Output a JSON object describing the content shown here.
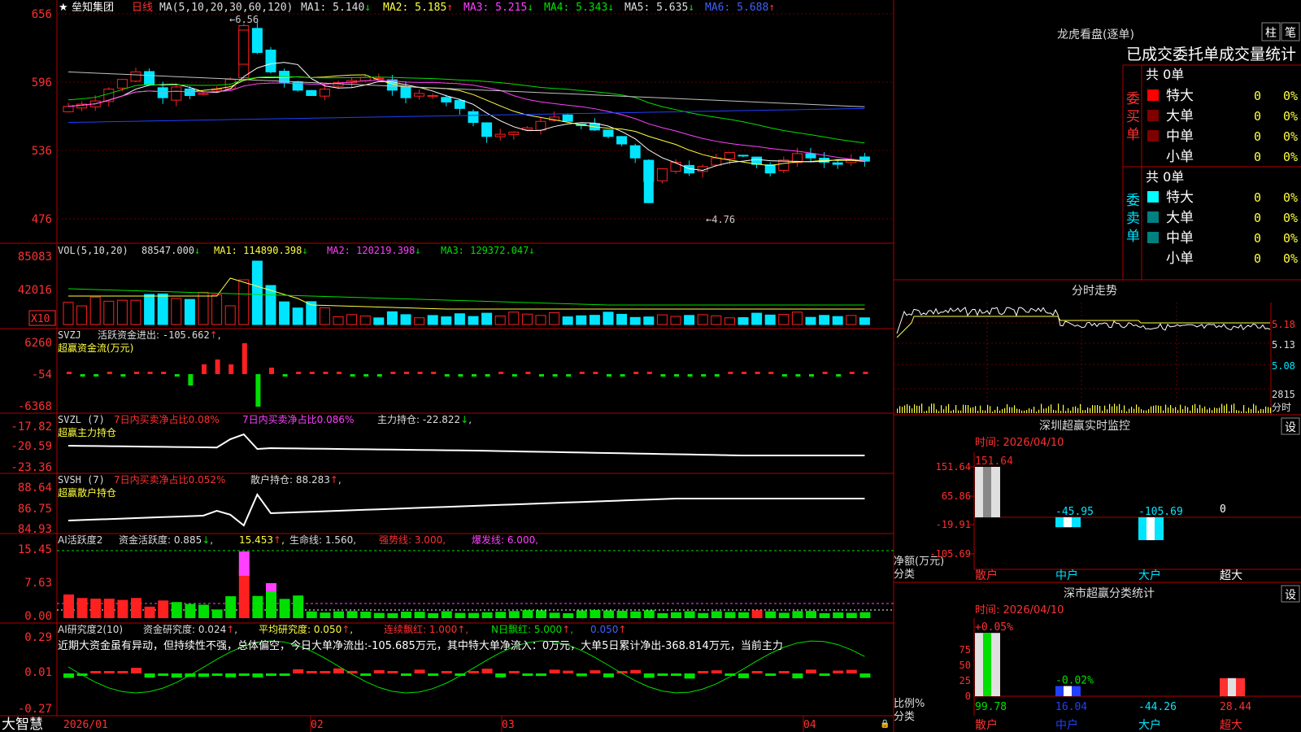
{
  "colors": {
    "up": "#ff2020",
    "down": "#00e5ff",
    "grid": "#b00000",
    "yellow": "#ffff40",
    "magenta": "#ff40ff",
    "green": "#00e000",
    "white": "#ffffff",
    "blue": "#2040ff",
    "grey": "#c0c0c0"
  },
  "stock": {
    "name": "垒知集团",
    "period": "日线",
    "star": "★"
  },
  "main": {
    "ma_params": "MA(5,10,20,30,60,120)",
    "ma": [
      {
        "label": "MA1:",
        "value": "5.140",
        "dir": "↓"
      },
      {
        "label": "MA2:",
        "value": "5.185",
        "dir": "↑"
      },
      {
        "label": "MA3:",
        "value": "5.215",
        "dir": "↓"
      },
      {
        "label": "MA4:",
        "value": "5.343",
        "dir": "↓"
      },
      {
        "label": "MA5:",
        "value": "5.635",
        "dir": "↓"
      },
      {
        "label": "MA6:",
        "value": "5.688",
        "dir": "↑"
      }
    ],
    "y_ticks": [
      "656",
      "596",
      "536",
      "476"
    ],
    "high_label": "6.56",
    "low_label": "4.76"
  },
  "vol": {
    "title": "VOL(5,10,20)",
    "value": "88547.000",
    "dir": "↓",
    "ma1": "MA1: 114890.398",
    "ma2": "MA2: 120219.398",
    "ma3": "MA3: 129372.047",
    "y_ticks": [
      "85083",
      "42016"
    ],
    "unit": "X10"
  },
  "svzj": {
    "title": "SVZJ",
    "label": "活跃资金进出:",
    "value": "-105.662",
    "dir": "↑",
    "sub": "超赢资金流(万元)",
    "y_ticks": [
      "6260",
      "-54",
      "-6368"
    ]
  },
  "svzl": {
    "title": "SVZL (7)",
    "ratio1": "7日内买卖净占比0.08%",
    "ratio2": "7日内买卖净占比0.086%",
    "hold": "主力持仓: -22.822",
    "dir": "↓",
    "sub": "超赢主力持仓",
    "y_ticks": [
      "-17.82",
      "-20.59",
      "-23.36"
    ]
  },
  "svsh": {
    "title": "SVSH (7)",
    "ratio": "7日内买卖净占比0.052%",
    "hold": "散户持仓: 88.283",
    "dir": "↑",
    "sub": "超赢散户持仓",
    "y_ticks": [
      "88.64",
      "86.75",
      "84.93"
    ]
  },
  "ai1": {
    "title": "AI活跃度2",
    "l1": "资金活跃度: 0.885",
    "l2": "15.453",
    "l3": "生命线: 1.560",
    "l4": "强势线: 3.000",
    "l5": "爆发线: 6.000",
    "y_ticks": [
      "15.45",
      "7.63",
      "0.00"
    ]
  },
  "ai2": {
    "title": "AI研究度2(10)",
    "l1": "资金研究度: 0.024",
    "l2": "平均研究度: 0.050",
    "l3": "连续飘红: 1.000",
    "l4": "N日飘红: 5.000",
    "l5": "0.050",
    "commentary": "近期大资金虽有异动，但持续性不强，总体偏空，今日大单净流出:-105.685万元，其中特大单净流入：0万元，大单5日累计净出-368.814万元，当前主力",
    "y_ticks": [
      "0.29",
      "0.01",
      "-0.27"
    ]
  },
  "xaxis": {
    "labels": [
      "2026/01",
      "02",
      "03",
      "04"
    ]
  },
  "app": {
    "name": "大智慧"
  },
  "lhb": {
    "title": "龙虎看盘(逐单)",
    "tab1": "柱",
    "tab2": "笔",
    "header": "已成交委托单成交量统计",
    "buy": {
      "label": "委买单",
      "total": "共 0单",
      "rows": [
        {
          "name": "特大",
          "v": "0",
          "p": "0%"
        },
        {
          "name": "大单",
          "v": "0",
          "p": "0%"
        },
        {
          "name": "中单",
          "v": "0",
          "p": "0%"
        },
        {
          "name": "小单",
          "v": "0",
          "p": "0%"
        }
      ]
    },
    "sell": {
      "label": "委卖单",
      "total": "共 0单",
      "rows": [
        {
          "name": "特大",
          "v": "0",
          "p": "0%"
        },
        {
          "name": "大单",
          "v": "0",
          "p": "0%"
        },
        {
          "name": "中单",
          "v": "0",
          "p": "0%"
        },
        {
          "name": "小单",
          "v": "0",
          "p": "0%"
        }
      ]
    }
  },
  "fenshi": {
    "title": "分时走势",
    "y_ticks": [
      "5.18",
      "5.13",
      "5.08"
    ],
    "vol_tick": "2815",
    "unit": "分时"
  },
  "monitor": {
    "title": "深圳超赢实时监控",
    "button": "设",
    "time": "时间: 2026/04/10",
    "y_ticks": [
      "151.64",
      "65.86",
      "-19.91",
      "-105.69"
    ],
    "ylabel": "净额(万元)",
    "xlabel": "分类",
    "chart_data": {
      "type": "bar",
      "categories": [
        "散户",
        "中户",
        "大户",
        "超大"
      ],
      "values": [
        151.64,
        -45.95,
        -105.69,
        0
      ],
      "labels": [
        "151.64",
        "-45.95",
        "-105.69",
        "0"
      ]
    }
  },
  "classify": {
    "title": "深市超赢分类统计",
    "button": "设",
    "time": "时间: 2026/04/10",
    "y_ticks": [
      "75",
      "50",
      "25",
      "0"
    ],
    "ylabel": "比例%",
    "xlabel": "分类",
    "chart_data": {
      "type": "bar",
      "categories": [
        "散户",
        "中户",
        "大户",
        "超大"
      ],
      "values": [
        99.78,
        16.04,
        -44.26,
        28.44
      ],
      "top_labels": [
        "+0.05%",
        "-0.02%",
        "",
        ""
      ]
    }
  },
  "chart_data": {
    "type": "candlestick",
    "x": [
      "2026/01",
      "02",
      "03",
      "04"
    ],
    "y_range": [
      4.76,
      6.56
    ],
    "high": 6.56,
    "low": 4.76
  }
}
